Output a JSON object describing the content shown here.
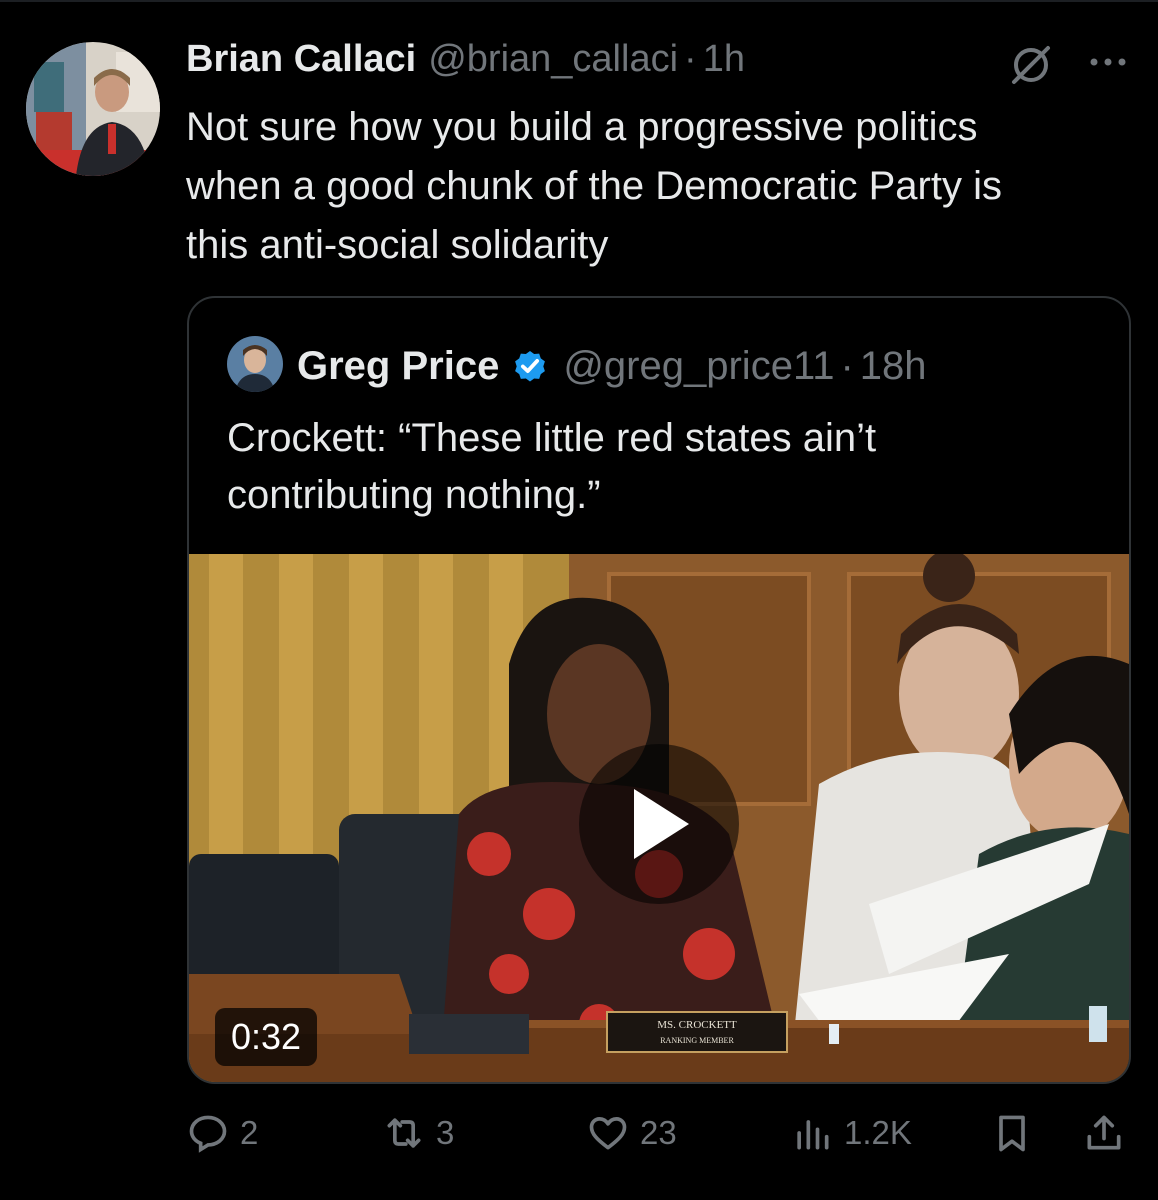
{
  "tweet": {
    "author_name": "Brian Callaci",
    "author_handle": "@brian_callaci",
    "separator": "·",
    "time": "1h",
    "text_lines": [
      "Not sure how you build a progressive politics",
      "when a good chunk of the Democratic Party is",
      "this anti-social solidarity"
    ],
    "icons": {
      "grok": "grok-icon",
      "more": "more-icon"
    }
  },
  "quote": {
    "author_name": "Greg Price",
    "author_handle": "@greg_price11",
    "separator": "·",
    "time": "18h",
    "verified": true,
    "text_lines": [
      "Crockett: “These little red states ain’t",
      "contributing nothing.”"
    ],
    "media": {
      "type": "video",
      "duration": "0:32",
      "nameplate_name": "MS. CROCKETT",
      "nameplate_title": "RANKING MEMBER"
    }
  },
  "actions": {
    "replies": "2",
    "reposts": "3",
    "likes": "23",
    "views": "1.2K"
  },
  "colors": {
    "background": "#000000",
    "text": "#e7e9ea",
    "secondary": "#71767b",
    "verified": "#1d9bf0",
    "border": "#2f3336"
  }
}
